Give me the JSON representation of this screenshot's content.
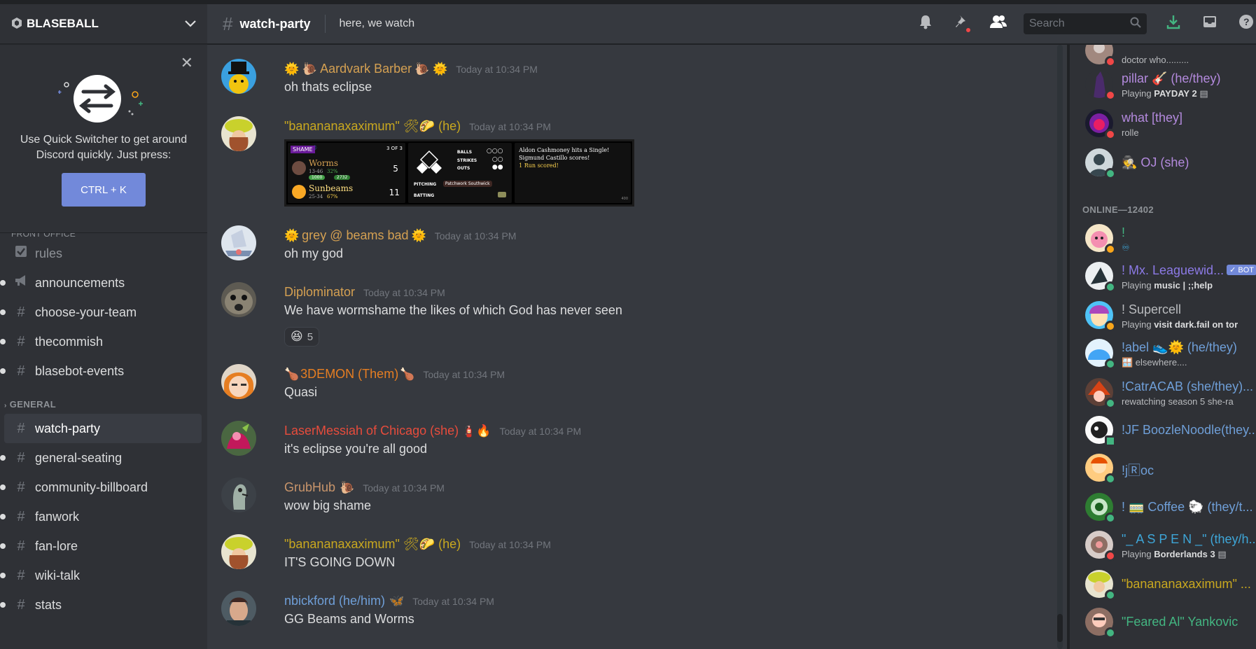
{
  "server": {
    "name": "BLASEBALL"
  },
  "quick_switcher": {
    "text": "Use Quick Switcher to get around Discord quickly. Just press:",
    "shortcut": "CTRL + K"
  },
  "channels": {
    "cut_category": "FRONT OFFICE",
    "top": [
      {
        "name": "rules",
        "icon": "rules-icon",
        "muted": true
      },
      {
        "name": "announcements",
        "icon": "megaphone-icon",
        "muted": false
      },
      {
        "name": "choose-your-team",
        "icon": "hash-icon",
        "muted": false
      },
      {
        "name": "thecommish",
        "icon": "hash-icon",
        "muted": false
      },
      {
        "name": "blasebot-events",
        "icon": "hash-icon",
        "muted": false
      }
    ],
    "general_category": "GENERAL",
    "general": [
      {
        "name": "watch-party",
        "selected": true
      },
      {
        "name": "general-seating"
      },
      {
        "name": "community-billboard"
      },
      {
        "name": "fanwork"
      },
      {
        "name": "fan-lore"
      },
      {
        "name": "wiki-talk"
      },
      {
        "name": "stats"
      }
    ]
  },
  "header": {
    "channel": "watch-party",
    "topic": "here, we watch",
    "search_placeholder": "Search"
  },
  "messages": [
    {
      "user": "Aardvark Barber",
      "prefix": "🌞 🐌",
      "suffix": "🐌 🌞",
      "color": "#d4a052",
      "time": "Today at 10:34 PM",
      "text": "oh thats eclipse"
    },
    {
      "user": "\"banananaxaximum\" 🛠🌮 (he)",
      "color": "#c9a81f",
      "time": "Today at 10:34 PM",
      "text": ""
    },
    {
      "user": "grey @ beams bad",
      "prefix": "🌞",
      "suffix": "🌞",
      "color": "#d4a052",
      "time": "Today at 10:34 PM",
      "text": "oh my god"
    },
    {
      "user": "Diplominator",
      "color": "#d4a052",
      "time": "Today at 10:34 PM",
      "text": "We have wormshame the likes of which God has never seen",
      "reaction": {
        "emoji": "😆",
        "count": "5"
      }
    },
    {
      "user": "3DEMON (Them)",
      "prefix": "🍗",
      "suffix": "🍗",
      "color": "#e67e22",
      "time": "Today at 10:34 PM",
      "text": "Quasi"
    },
    {
      "user": "LaserMessiah of Chicago (she)",
      "suffix": "🧯🔥",
      "color": "#e74c3c",
      "time": "Today at 10:34 PM",
      "text": "it's eclipse you're all good"
    },
    {
      "user": "GrubHub",
      "suffix": "🐌",
      "color": "#c9956b",
      "time": "Today at 10:34 PM",
      "text": "wow big shame"
    },
    {
      "user": "\"banananaxaximum\" 🛠🌮 (he)",
      "color": "#c9a81f",
      "time": "Today at 10:34 PM",
      "text": "IT'S GOING DOWN"
    },
    {
      "user": "nbickford (he/him)",
      "suffix": "🦋",
      "color": "#6f9fd8",
      "time": "Today at 10:34 PM",
      "text": "GG Beams and Worms"
    }
  ],
  "game_embed": {
    "badge": "SHAME",
    "series": "3 OF 3",
    "away_team": "Worms",
    "away_record": "13-46",
    "away_pct": "32%",
    "away_score": "5",
    "away_pill": "1000",
    "away_pill2": "2732",
    "home_team": "Sunbeams",
    "home_record": "25-34",
    "home_pct": "67%",
    "home_score": "11",
    "balls_label": "BALLS",
    "strikes_label": "STRIKES",
    "outs_label": "OUTS",
    "pitching_label": "PITCHING",
    "pitcher": "Patchwork Southwick",
    "batting_label": "BATTING",
    "log1": "Aldon Cashmoney hits a Single!",
    "log2": "Sigmund Castillo scores!",
    "log3": "1 Run scored!",
    "footer": "400"
  },
  "members": {
    "online_header": "ONLINE—12402",
    "top": [
      {
        "name": "doctor who.........",
        "activity": "",
        "color": "#b9bbbe",
        "status": "dnd",
        "partial": true
      },
      {
        "name": "pillar 🎸 (he/they)",
        "activity_prefix": "Playing",
        "activity": "PAYDAY 2",
        "color": "#b48ade",
        "status": "dnd"
      },
      {
        "name": "what [they]",
        "activity": "rolle",
        "color": "#b48ade",
        "status": "dnd"
      },
      {
        "name": "🕵 OJ (she)",
        "activity": "",
        "color": "#b48ade",
        "status": "online"
      }
    ],
    "online": [
      {
        "name": "!",
        "activity": "♾",
        "color": "#43b581",
        "status": "idle"
      },
      {
        "name": "! Mx. Leaguewid...",
        "activity_prefix": "Playing",
        "activity": "music | ;;help",
        "color": "#8c7ae6",
        "status": "online",
        "bot": "✓ BOT"
      },
      {
        "name": "! Supercell",
        "activity_prefix": "Playing",
        "activity": "visit dark.fail on tor",
        "color": "#b9bbbe",
        "status": "idle"
      },
      {
        "name": "!abel 👟🌞 (he/they)",
        "activity": "🪟 elsewhere....",
        "color": "#6f9fd8",
        "status": "online"
      },
      {
        "name": "!CatrACAB (she/they)...",
        "activity": "rewatching season 5 she-ra",
        "color": "#6f9fd8",
        "status": "online"
      },
      {
        "name": "!JF BoozleNoodle(they...",
        "activity": "",
        "color": "#6f9fd8",
        "status": "mobile"
      },
      {
        "name": "!j🅁oc",
        "activity": "",
        "color": "#6f9fd8",
        "status": "online"
      },
      {
        "name": "! 🚃 Coffee 🐑 (they/t...",
        "activity": "",
        "color": "#6f9fd8",
        "status": "online"
      },
      {
        "name": "\"_ A S P E N _\" (they/h...",
        "activity_prefix": "Playing",
        "activity": "Borderlands 3",
        "color": "#3ea6d8",
        "status": "dnd"
      },
      {
        "name": "\"banananaxaximum\" ...",
        "activity": "",
        "color": "#c9a81f",
        "status": "online"
      },
      {
        "name": "\"Feared Al\" Yankovic",
        "activity": "",
        "color": "#43b581",
        "status": "online"
      }
    ]
  },
  "colors": {
    "accent": "#7289da",
    "online": "#43b581",
    "idle": "#faa61a",
    "dnd": "#f04747"
  }
}
